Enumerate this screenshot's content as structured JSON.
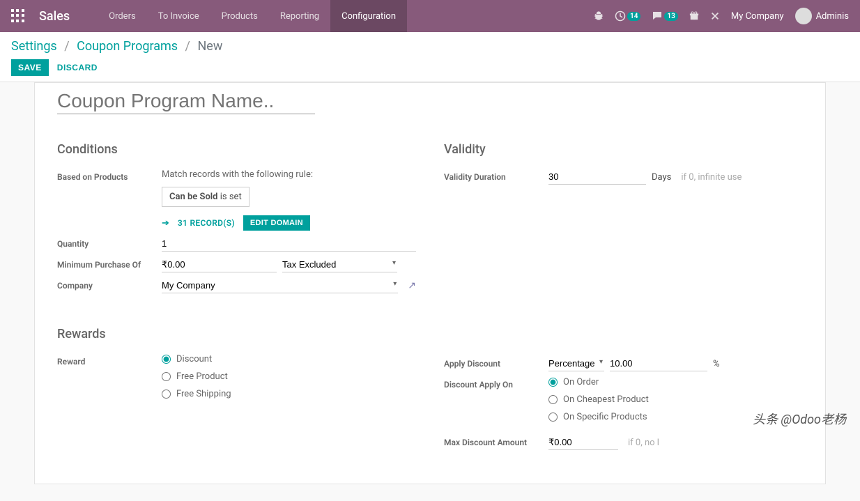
{
  "nav": {
    "brand": "Sales",
    "items": [
      "Orders",
      "To Invoice",
      "Products",
      "Reporting",
      "Configuration"
    ],
    "active_index": 4,
    "activities_badge": "14",
    "messages_badge": "13",
    "company": "My Company",
    "user": "Adminis"
  },
  "breadcrumb": {
    "root": "Settings",
    "parent": "Coupon Programs",
    "current": "New",
    "sep": "/"
  },
  "buttons": {
    "save": "SAVE",
    "discard": "DISCARD"
  },
  "form": {
    "title_placeholder": "Coupon Program Name..",
    "sections": {
      "conditions": "Conditions",
      "validity": "Validity",
      "rewards": "Rewards"
    },
    "labels": {
      "based_on_products": "Based on Products",
      "quantity": "Quantity",
      "min_purchase": "Minimum Purchase Of",
      "company": "Company",
      "validity_duration": "Validity Duration",
      "reward": "Reward",
      "apply_discount": "Apply Discount",
      "discount_apply_on": "Discount Apply On",
      "max_discount": "Max Discount Amount"
    },
    "domain": {
      "match_text": "Match records with the following rule:",
      "tag_field": "Can be Sold",
      "tag_op": "is set",
      "records": "31 RECORD(S)",
      "edit": "EDIT DOMAIN"
    },
    "values": {
      "quantity": "1",
      "min_purchase": "₹0.00",
      "tax_rule": "Tax Excluded",
      "company": "My Company",
      "validity_duration": "30",
      "days_label": "Days",
      "validity_hint": "if 0, infinite use",
      "discount_type": "Percentage",
      "discount_value": "10.00",
      "percent_symbol": "%",
      "max_discount": "₹0.00",
      "max_hint": "if 0, no l"
    },
    "reward_options": [
      "Discount",
      "Free Product",
      "Free Shipping"
    ],
    "apply_on_options": [
      "On Order",
      "On Cheapest Product",
      "On Specific Products"
    ]
  },
  "watermark": "头条 @Odoo老杨"
}
